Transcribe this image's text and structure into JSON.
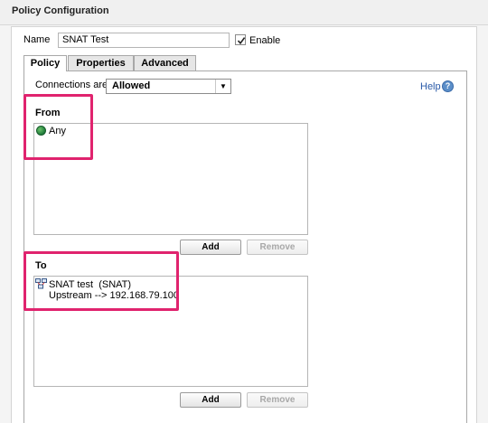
{
  "header": {
    "title": "Policy Configuration"
  },
  "form": {
    "name_label": "Name",
    "name_value": "SNAT Test",
    "enable_label": "Enable",
    "enable_checked": true
  },
  "tabs": [
    {
      "label": "Policy",
      "active": true
    },
    {
      "label": "Properties",
      "active": false
    },
    {
      "label": "Advanced",
      "active": false
    }
  ],
  "policy": {
    "connections_label": "Connections are",
    "connections_value": "Allowed",
    "help_label": "Help",
    "help_icon": "?"
  },
  "from": {
    "label": "From",
    "items": [
      {
        "icon": "globe-icon",
        "text": "Any"
      }
    ],
    "add_label": "Add",
    "remove_label": "Remove"
  },
  "to": {
    "label": "To",
    "items": [
      {
        "icon": "snat-icon",
        "line1": "SNAT test  (SNAT)",
        "line2": "Upstream --> 192.168.79.100"
      }
    ],
    "add_label": "Add",
    "remove_label": "Remove"
  },
  "colors": {
    "highlight": "#e0236e",
    "link": "#2a5aa8"
  }
}
